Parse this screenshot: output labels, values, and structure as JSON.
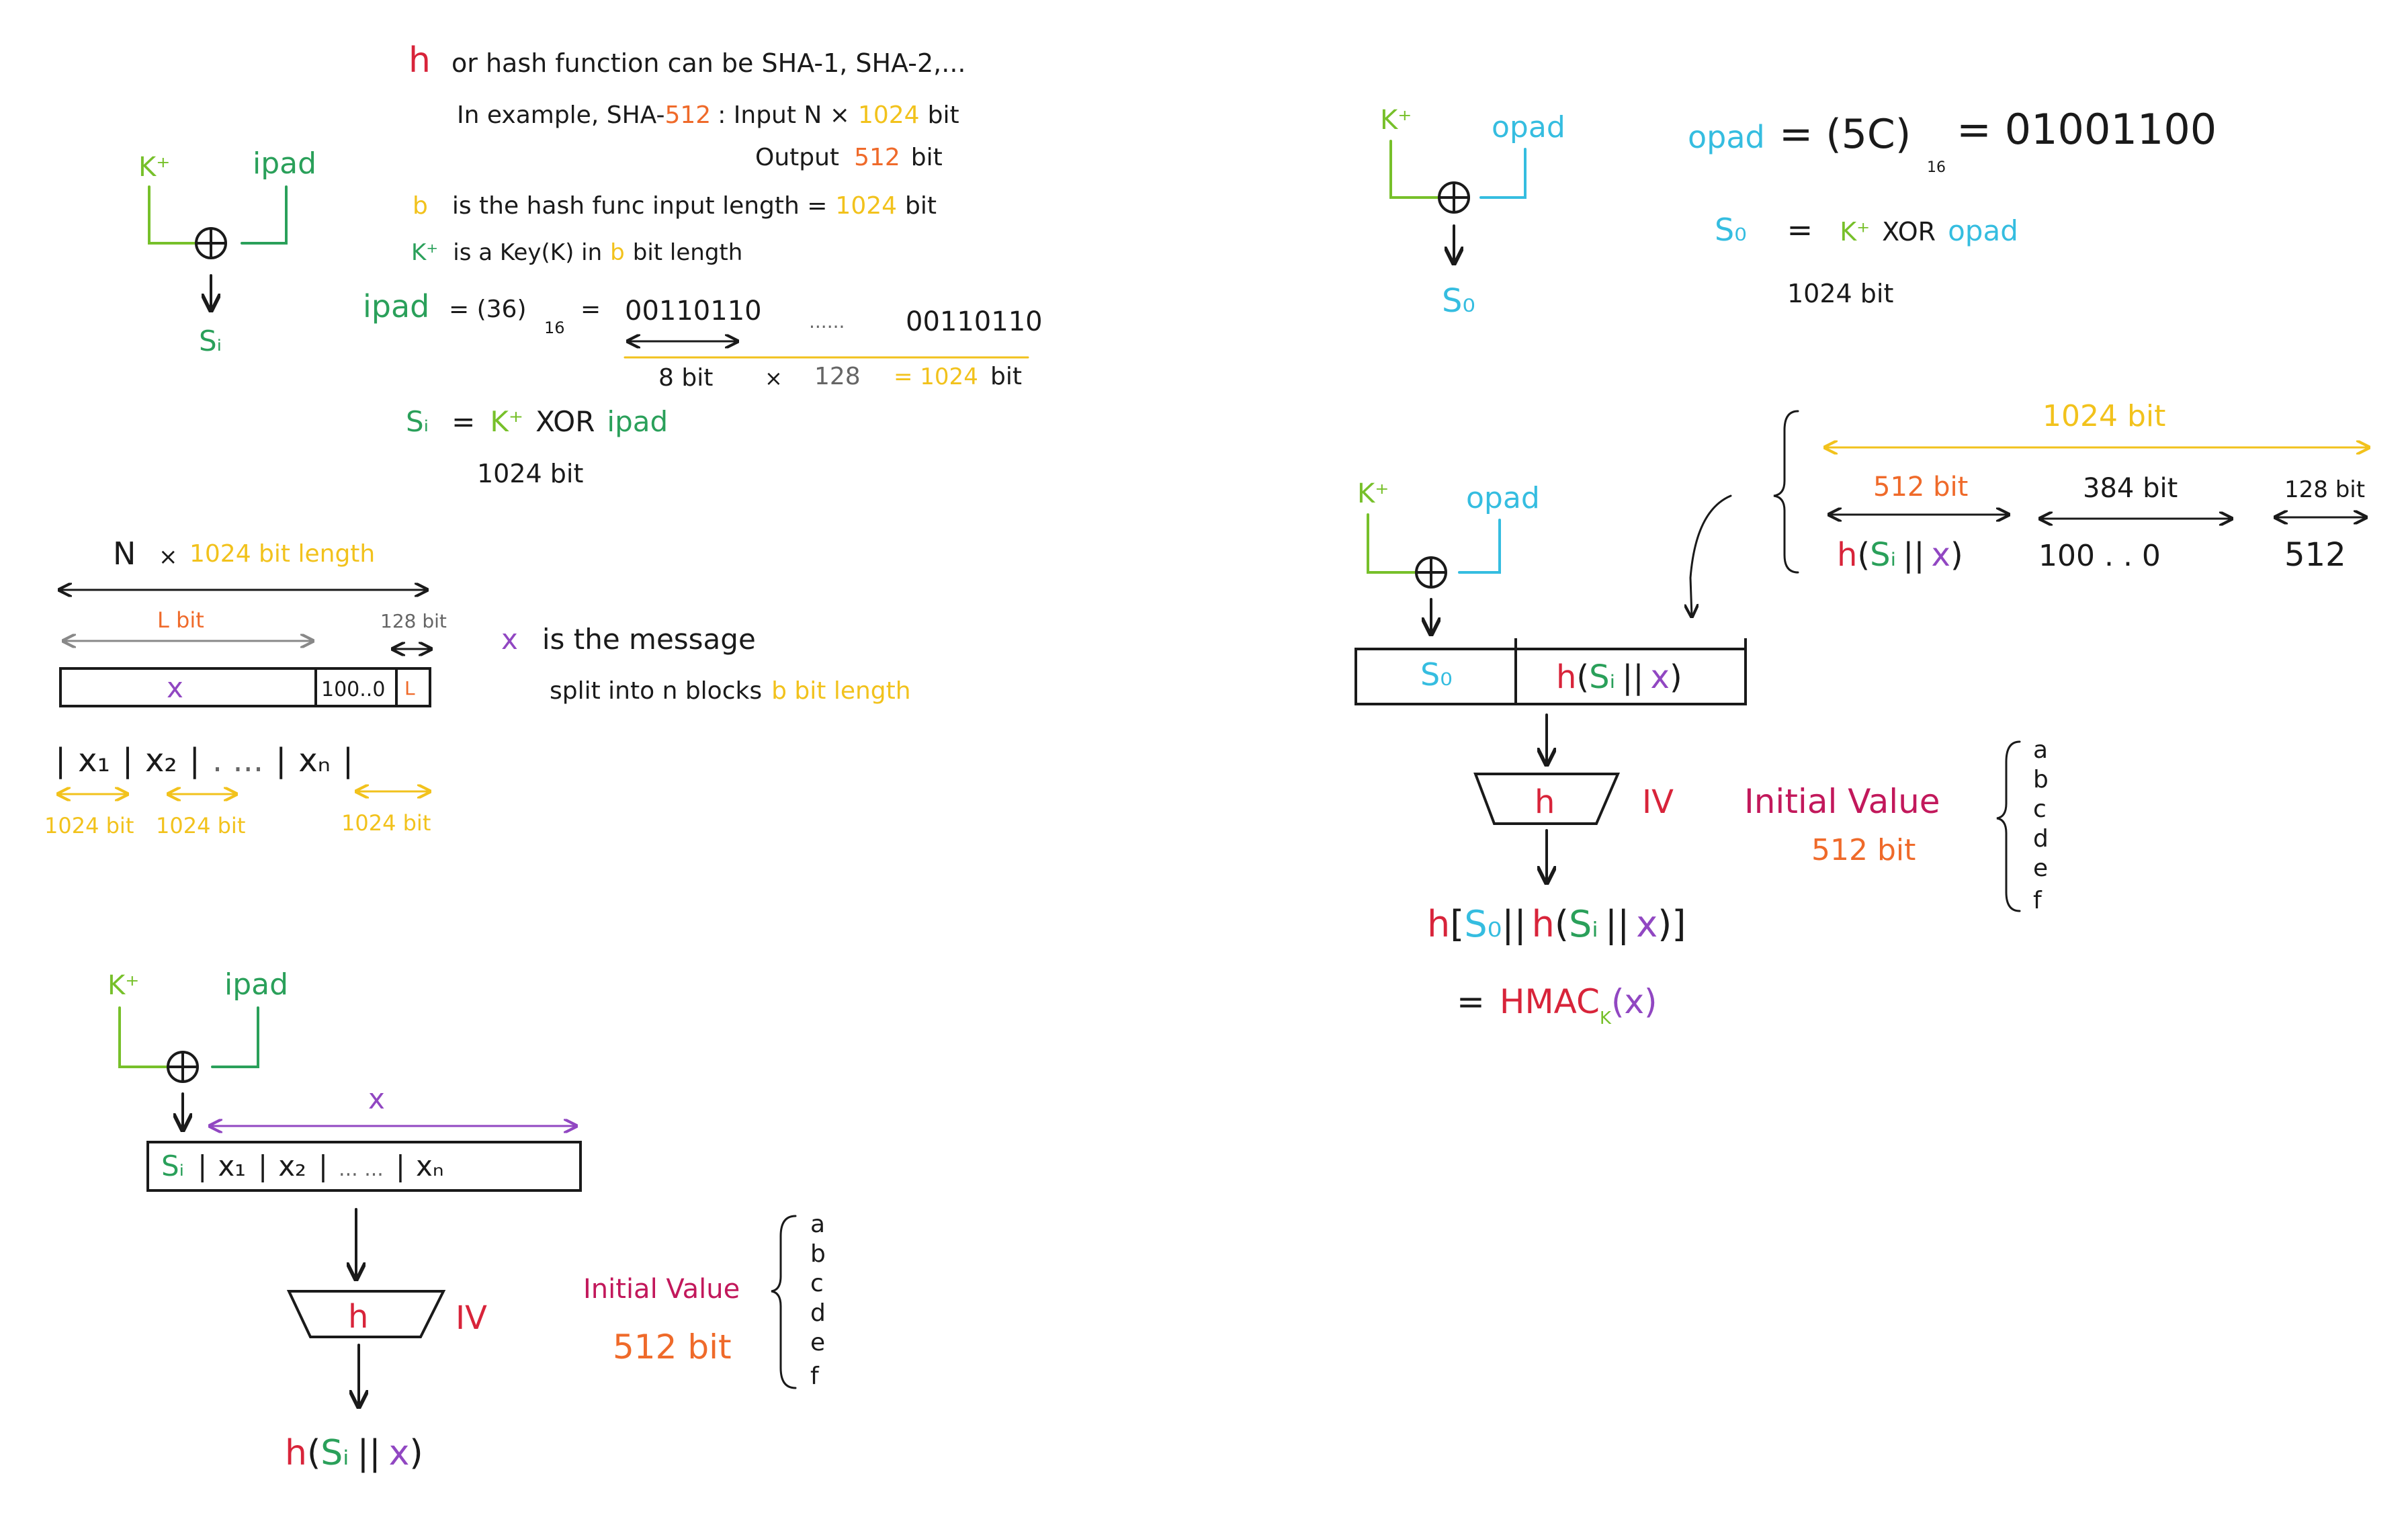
{
  "colors": {
    "red": "#d8243a",
    "orange": "#ef6a2a",
    "yellow": "#f2c21c",
    "green": "#2aa05a",
    "lime": "#77c02a",
    "cyan": "#35bde0",
    "purple": "#9147c2",
    "magenta": "#c2185b",
    "ink": "#1a1a1a"
  },
  "notes": {
    "h_sym": "h",
    "h_desc": "or hash function can be SHA-1, SHA-2,...",
    "example": "In example, SHA-",
    "example_512": "512",
    "example_input": ": Input   N ×",
    "example_input_1024": "1024",
    "example_input_bit": "bit",
    "output": "Output",
    "output_512": "512",
    "output_bit": "bit",
    "b_sym": "b",
    "b_desc": "is the hash func input length =",
    "b_1024": "1024",
    "b_bit": "bit",
    "k_sym": "K⁺",
    "k_desc": "is a Key(K) in",
    "k_b": "b",
    "k_tail": "bit length",
    "ipad_label": "ipad",
    "ipad_eq": "= (36)",
    "ipad_sub": "16",
    "ipad_eq2": "=",
    "ipad_bin": "00110110",
    "ipad_dots": "......",
    "ipad_bin2": "00110110",
    "ipad_8bit": "8 bit",
    "ipad_x": "×",
    "ipad_128": "128",
    "ipad_eq1024": "= 1024",
    "ipad_bit": "bit",
    "si_sym": "Sᵢ",
    "si_eq": "=",
    "si_k": "K⁺",
    "si_xor": "XOR",
    "si_ipad": "ipad",
    "si_1024": "1024 bit"
  },
  "xor_box_1": {
    "k": "K⁺",
    "pad": "ipad",
    "out": "Sᵢ"
  },
  "xor_box_2": {
    "k": "K⁺",
    "pad": "opad",
    "out": "S₀"
  },
  "xor_box_3": {
    "k": "K⁺",
    "pad": "ipad"
  },
  "xor_box_4": {
    "k": "K⁺",
    "pad": "opad"
  },
  "xor_symbol": "⊕",
  "opad_block": {
    "opad_label": "opad",
    "opad_eq": "= (5C)",
    "opad_sub": "16",
    "opad_eq2": "= 01001100",
    "so_sym": "S₀",
    "so_eq": "=",
    "so_k": "K⁺",
    "so_xor": "XOR",
    "so_opad": "opad",
    "so_1024": "1024 bit"
  },
  "message_block": {
    "n_label": "N",
    "n_x": "×",
    "n_len": "1024 bit length",
    "l_bit": "L bit",
    "bit128": "128 bit",
    "x_sym": "x",
    "pad": "100..0",
    "l_sym": "L",
    "x1": "x₁",
    "x2": "x₂",
    "dots": ". ...",
    "xn": "xₙ",
    "b1": "1024 bit",
    "b2": "1024 bit",
    "b3": "1024 bit",
    "x_desc_sym": "x",
    "x_desc": "is the message",
    "x_desc2": "split into n blocks",
    "x_desc2_b": "b bit length"
  },
  "inner_hash": {
    "x_sym": "x",
    "si": "Sᵢ",
    "x1": "x₁",
    "x2": "x₂",
    "dots": "...   ...",
    "xn": "xₙ",
    "h": "h",
    "iv": "IV",
    "initial_value": "Initial Value",
    "iv_512": "512 bit",
    "result_h": "h",
    "result_si": "Sᵢ",
    "result_sep": "||",
    "result_x": "x",
    "registers": [
      "a",
      "b",
      "c",
      "d",
      "e",
      "f"
    ]
  },
  "outer_hash": {
    "total": "1024 bit",
    "s512": "512 bit",
    "s384": "384 bit",
    "s128": "128 bit",
    "h_si_x_h": "h",
    "h_si_x_si": "Sᵢ",
    "h_si_x_sep": "||",
    "h_si_x_x": "x",
    "pad_val": "100 .    . 0",
    "len_val": "512",
    "so": "S₀",
    "h": "h",
    "iv": "IV",
    "initial_value": "Initial Value",
    "iv_512": "512 bit",
    "registers": [
      "a",
      "b",
      "c",
      "d",
      "e",
      "f"
    ],
    "final_h": "h",
    "final_so": "S₀",
    "final_sep": "||",
    "final_h2": "h",
    "final_si": "Sᵢ",
    "final_sep2": "||",
    "final_x": "x",
    "hmac_eq": "=",
    "hmac": "HMAC",
    "hmac_sub": "K",
    "hmac_x": "(x)"
  }
}
